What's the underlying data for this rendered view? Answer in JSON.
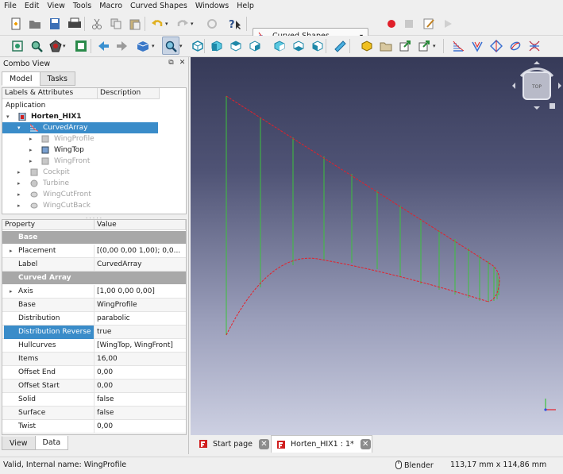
{
  "menu": [
    "File",
    "Edit",
    "View",
    "Tools",
    "Macro",
    "Curved Shapes",
    "Windows",
    "Help"
  ],
  "workbench": {
    "selected": "Curved Shapes"
  },
  "combo": {
    "title": "Combo View",
    "tabs": [
      "Model",
      "Tasks"
    ],
    "tree_headers": [
      "Labels & Attributes",
      "Description"
    ],
    "tree_root": "Application",
    "tree": [
      {
        "label": "Horten_HIX1",
        "bold": true
      },
      {
        "label": "CurvedArray"
      },
      {
        "label": "WingProfile"
      },
      {
        "label": "WingTop"
      },
      {
        "label": "WingFront"
      },
      {
        "label": "Cockpit"
      },
      {
        "label": "Turbine"
      },
      {
        "label": "WingCutFront"
      },
      {
        "label": "WingCutBack"
      }
    ],
    "prop_headers": [
      "Property",
      "Value"
    ],
    "props": [
      {
        "group": "Base"
      },
      {
        "name": "Placement",
        "value": "[(0,00 0,00 1,00); 0,0..."
      },
      {
        "name": "Label",
        "value": "CurvedArray"
      },
      {
        "group": "Curved Array"
      },
      {
        "name": "Axis",
        "value": "[1,00 0,00 0,00]"
      },
      {
        "name": "Base",
        "value": "WingProfile"
      },
      {
        "name": "Distribution",
        "value": "parabolic"
      },
      {
        "name": "Distribution Reverse",
        "value": "true"
      },
      {
        "name": "Hullcurves",
        "value": "[WingTop, WingFront]"
      },
      {
        "name": "Items",
        "value": "16,00"
      },
      {
        "name": "Offset End",
        "value": "0,00"
      },
      {
        "name": "Offset Start",
        "value": "0,00"
      },
      {
        "name": "Solid",
        "value": "false"
      },
      {
        "name": "Surface",
        "value": "false"
      },
      {
        "name": "Twist",
        "value": "0,00"
      }
    ],
    "bottom_tabs": [
      "View",
      "Data"
    ]
  },
  "navcube": {
    "face": "TOP"
  },
  "doc_tabs": [
    {
      "label": "Start page"
    },
    {
      "label": "Horten_HIX1 : 1*"
    }
  ],
  "status": {
    "message": "Valid, Internal name: WingProfile",
    "nav_style": "Blender",
    "dimensions": "113,17 mm x 114,86 mm"
  },
  "colors": {
    "selection": "#3a8cc9",
    "curve_red": "#e5202a",
    "rib_green": "#3cc23c"
  }
}
